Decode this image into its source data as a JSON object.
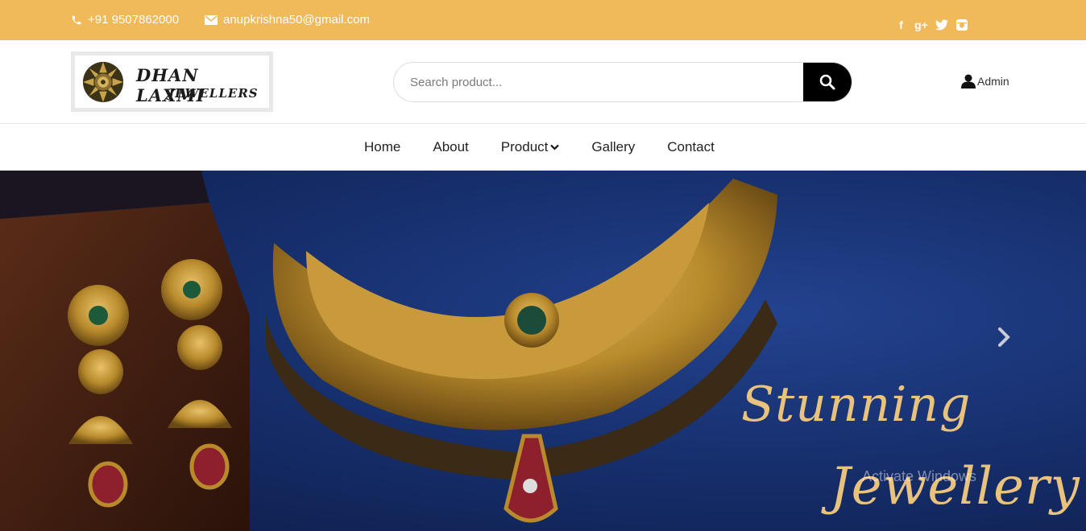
{
  "topbar": {
    "phone": "+91 9507862000",
    "email": "anupkrishna50@gmail.com",
    "social": [
      {
        "icon": "facebook-icon",
        "glyph": "f"
      },
      {
        "icon": "google-plus-icon",
        "glyph": "g+"
      },
      {
        "icon": "twitter-icon",
        "glyph": "t"
      },
      {
        "icon": "instagram-icon",
        "glyph": "◘"
      }
    ]
  },
  "header": {
    "logo_line1": "DHAN LAXMI",
    "logo_line2": "JEWELLERS",
    "search_placeholder": "Search product...",
    "admin_label": "Admin"
  },
  "nav": {
    "items": [
      "Home",
      "About",
      "Product",
      "Gallery",
      "Contact"
    ]
  },
  "hero": {
    "slogan_line1": "Stunning",
    "slogan_line2": "Jewellery",
    "watermark": "Activate Windows"
  },
  "colors": {
    "topbar": "#f0b95a",
    "accent_gold": "#e9c27d",
    "search_button": "#000000"
  }
}
